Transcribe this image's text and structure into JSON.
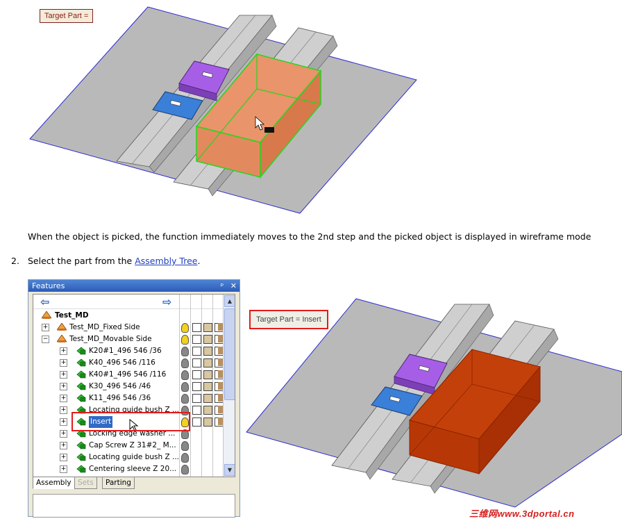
{
  "top": {
    "prompt_label": "Target Part ="
  },
  "text": {
    "description": "When the object is picked, the function immediately moves to the 2nd step and the picked object is displayed in wireframe mode",
    "step_number": "2.",
    "step_text_before": "Select the part from the",
    "step_link": "Assembly Tree",
    "step_text_after": "."
  },
  "panel": {
    "title": "Features",
    "pin": "ᵖ",
    "close": "✕",
    "root": "Test_MD",
    "rows": [
      {
        "label": "Test_MD_Fixed Side",
        "indent": 1,
        "exp": "+",
        "bulb": "#f2d21a",
        "tools": 4
      },
      {
        "label": "Test_MD_Movable Side",
        "indent": 1,
        "exp": "−",
        "bulb": "#f2d21a",
        "tools": 4
      },
      {
        "label": "K20#1_496 546 /36",
        "indent": 2,
        "exp": "+",
        "bulb": "#888888",
        "tools": 4
      },
      {
        "label": "K40_496 546 /116",
        "indent": 2,
        "exp": "+",
        "bulb": "#888888",
        "tools": 4
      },
      {
        "label": "K40#1_496 546 /116",
        "indent": 2,
        "exp": "+",
        "bulb": "#888888",
        "tools": 4
      },
      {
        "label": "K30_496 546 /46",
        "indent": 2,
        "exp": "+",
        "bulb": "#888888",
        "tools": 4
      },
      {
        "label": "K11_496 546 /36",
        "indent": 2,
        "exp": "+",
        "bulb": "#888888",
        "tools": 4
      },
      {
        "label": "Locating guide bush Z ...",
        "indent": 2,
        "exp": "+",
        "bulb": "#888888",
        "tools": 4
      },
      {
        "label": "Insert",
        "indent": 2,
        "exp": "+",
        "bulb": "#f2d21a",
        "tools": 4,
        "selected": true
      },
      {
        "label": "Locking edge washer ...",
        "indent": 2,
        "exp": "+",
        "bulb": "#888888",
        "tools": 0
      },
      {
        "label": "Cap Screw Z 31#2_ M...",
        "indent": 2,
        "exp": "+",
        "bulb": "#888888",
        "tools": 0
      },
      {
        "label": "Locating guide bush Z ...",
        "indent": 2,
        "exp": "+",
        "bulb": "#888888",
        "tools": 0
      },
      {
        "label": "Centering sleeve Z 20...",
        "indent": 2,
        "exp": "+",
        "bulb": "#888888",
        "tools": 0
      }
    ],
    "tabs": [
      "Assembly",
      "Sets",
      "Parting"
    ]
  },
  "bottom": {
    "prompt_label": "Target Part = Insert"
  },
  "watermark": "三维网www.3dportal.cn",
  "colors": {
    "plate": "#b9b9b9",
    "rail": "#c9c9c9",
    "purple": "#a75ee6",
    "blue": "#3a7fd8",
    "orange_pick": "#e9946a",
    "green_wire": "#25d61f",
    "insert_red": "#c4400a",
    "outline_blue": "#2b2bd0"
  }
}
